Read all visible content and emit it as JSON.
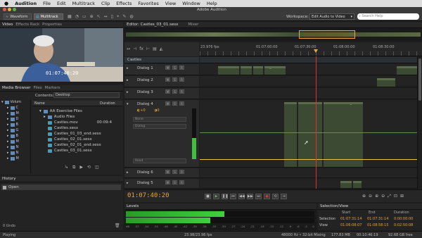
{
  "menubar": {
    "apple": "",
    "app": "Audition",
    "items": [
      "File",
      "Edit",
      "Multitrack",
      "Clip",
      "Effects",
      "Favorites",
      "View",
      "Window",
      "Help"
    ]
  },
  "titlebar": {
    "title": "Adobe Audition",
    "btn_waveform": "Waveform",
    "btn_multitrack": "Multitrack",
    "workspace_label": "Workspace:",
    "workspace_value": "Edit Audio to Video",
    "search_placeholder": "Search Help"
  },
  "video_panel": {
    "tabs": [
      "Video",
      "Effects Rack",
      "Properties"
    ],
    "timecode": "01:07:40:20"
  },
  "media_browser": {
    "tabs": [
      "Media Browser",
      "Files",
      "Markers"
    ],
    "contents_label": "Contents:",
    "contents_value": "Desktop",
    "tree": [
      "Volum",
      "C",
      "M",
      "D",
      "B",
      "G",
      "B",
      "M",
      "N",
      "N",
      "M"
    ],
    "col_name": "Name",
    "col_duration": "Duration",
    "files": [
      {
        "name": "AA Exercise Files",
        "dur": "",
        "type": "folder"
      },
      {
        "name": "Audio Files",
        "dur": "",
        "type": "folder"
      },
      {
        "name": "Castles.mov",
        "dur": "00:09:4",
        "type": "file"
      },
      {
        "name": "Castles.sesx",
        "dur": "",
        "type": "file"
      },
      {
        "name": "Castles_01_03_end.sesx",
        "dur": "",
        "type": "file"
      },
      {
        "name": "Castles_02_01.sesx",
        "dur": "",
        "type": "file"
      },
      {
        "name": "Castles_02_01_end.sesx",
        "dur": "",
        "type": "file"
      },
      {
        "name": "Castles_03_01.sesx",
        "dur": "",
        "type": "file"
      }
    ]
  },
  "history": {
    "tab": "History",
    "item": "Open",
    "undo_count": "0 Undo"
  },
  "editor": {
    "tabs": [
      "Editor: Castles_03_01.sesx",
      "Mixer"
    ],
    "fps": "23.976 fps",
    "ruler": [
      "01:07:00:00",
      "01:07:30:00",
      "01:08:00:00",
      "01:08:30:00"
    ],
    "session_track": "Castles",
    "current_time": "01:07:40:20"
  },
  "tracks": [
    {
      "name": "Dialog 1",
      "clips": [
        "..12",
        "...",
        "..s",
        "..s_73",
        ".22"
      ]
    },
    {
      "name": "Dialog 2",
      "clips": [
        ".13"
      ]
    },
    {
      "name": "Dialog 3",
      "clips": []
    },
    {
      "name": "Dialog 4",
      "clips": [
        ".16",
        "Castle...3",
        "Castles...d-cues_109"
      ],
      "rows": [
        "None",
        "Dialog",
        "Read"
      ]
    },
    {
      "name": "Dialog 6",
      "clips": []
    },
    {
      "name": "Dialog 5",
      "clips": [
        "..29",
        ".36"
      ]
    }
  ],
  "levels": {
    "tab": "Levels",
    "ticks": [
      "dB",
      "-57",
      "-54",
      "-51",
      "-48",
      "-45",
      "-42",
      "-39",
      "-36",
      "-33",
      "-30",
      "-27",
      "-24",
      "-21",
      "-18",
      "-15",
      "-12",
      "-9",
      "-6",
      "-3",
      "0"
    ]
  },
  "selection_view": {
    "tab": "Selection/View",
    "headers": [
      "Start",
      "End",
      "Duration"
    ],
    "rows": [
      {
        "label": "Selection",
        "start": "01:07:31:14",
        "end": "01:07:31:14",
        "duration": "0:00:00:00"
      },
      {
        "label": "View",
        "start": "01:06:08:07",
        "end": "01:08:58:15",
        "duration": "0:02:50:08"
      }
    ]
  },
  "statusbar": {
    "left": "Playing",
    "fps": "23.98/23.98 fps",
    "rate": "48000 Hz • 32-bit Mixing",
    "size": "177.83 MB",
    "dur": "00:10:46:19",
    "free": "92.68 GB free"
  },
  "colors": {
    "accent": "#e8a53b",
    "clip_green": "#3c4a33",
    "playhead": "#e03030",
    "timecode_orange": "#e6a140"
  }
}
